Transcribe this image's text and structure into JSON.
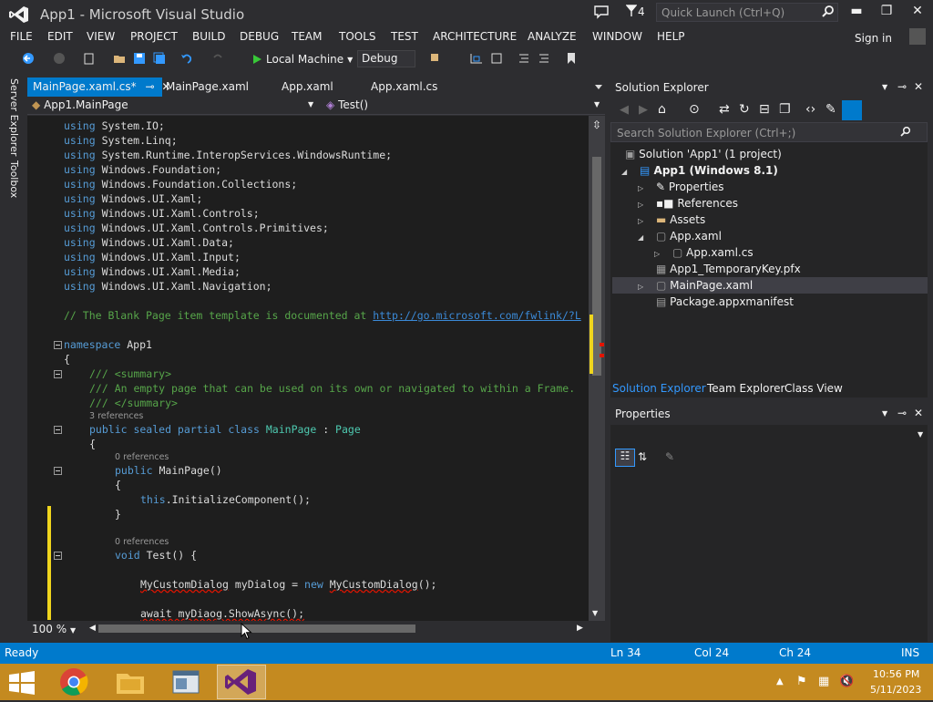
{
  "window": {
    "title": "App1 - Microsoft Visual Studio",
    "notification_count": "4",
    "quick_launch_placeholder": "Quick Launch (Ctrl+Q)",
    "minimize": "▬",
    "maximize": "❐",
    "close": "✕"
  },
  "menu": {
    "items": [
      "FILE",
      "EDIT",
      "VIEW",
      "PROJECT",
      "BUILD",
      "DEBUG",
      "TEAM",
      "TOOLS",
      "TEST",
      "ARCHITECTURE",
      "ANALYZE",
      "WINDOW",
      "HELP"
    ],
    "sign_in": "Sign in"
  },
  "toolbar": {
    "run_target": "Local Machine",
    "configuration": "Debug"
  },
  "left_strip": {
    "server_explorer": "Server Explorer",
    "toolbox": "Toolbox"
  },
  "doc_tabs": {
    "active": "MainPage.xaml.cs*",
    "tab2": "MainPage.xaml",
    "tab3": "App.xaml",
    "tab4": "App.xaml.cs"
  },
  "nav_bar": {
    "class": "App1.MainPage",
    "member": "Test()"
  },
  "code": {
    "using1": "System.IO;",
    "using2": "System.Linq;",
    "using3": "System.Runtime.InteropServices.WindowsRuntime;",
    "using4": "Windows.Foundation;",
    "using5": "Windows.Foundation.Collections;",
    "using6": "Windows.UI.Xaml;",
    "using7": "Windows.UI.Xaml.Controls;",
    "using8": "Windows.UI.Xaml.Controls.Primitives;",
    "using9": "Windows.UI.Xaml.Data;",
    "using10": "Windows.UI.Xaml.Input;",
    "using11": "Windows.UI.Xaml.Media;",
    "using12": "Windows.UI.Xaml.Navigation;",
    "using_kw": "using",
    "comment_blank": "// The Blank Page item template is documented at ",
    "comment_link": "http://go.microsoft.com/fwlink/?L",
    "ns_kw": "namespace",
    "ns_name": " App1",
    "brace_open": "{",
    "brace_close": "}",
    "summary_open": "/// <summary>",
    "summary_text": "/// An empty page that can be used on its own or navigated to within a Frame.",
    "summary_close": "/// </summary>",
    "refs3": "3 references",
    "class_kw": "public sealed partial class",
    "class_name": "MainPage",
    "class_colon": " : ",
    "class_base": "Page",
    "refs0a": "0 references",
    "ctor_kw": "public",
    "ctor_name": " MainPage()",
    "init_this": "this",
    "init_call": ".InitializeComponent();",
    "refs0b": "0 references",
    "void_kw": "void",
    "test_sig": " Test() {",
    "dialog_type": "MyCustomDialog",
    "dialog_var": " myDialog = ",
    "new_kw": "new",
    "dialog_ctor": "MyCustomDialog",
    "dialog_end": "();",
    "await_line": "await myDiaog.ShowAsync();"
  },
  "editor": {
    "zoom": "100 %"
  },
  "solution_explorer": {
    "title": "Solution Explorer",
    "search_placeholder": "Search Solution Explorer (Ctrl+;)",
    "items": [
      "Solution 'App1' (1 project)",
      "App1 (Windows 8.1)",
      "Properties",
      "References",
      "Assets",
      "App.xaml",
      "App.xaml.cs",
      "App1_TemporaryKey.pfx",
      "MainPage.xaml",
      "Package.appxmanifest"
    ],
    "tabs": [
      "Solution Explorer",
      "Team Explorer",
      "Class View"
    ]
  },
  "properties": {
    "title": "Properties"
  },
  "status": {
    "state": "Ready",
    "line": "Ln 34",
    "col": "Col 24",
    "ch": "Ch 24",
    "mode": "INS"
  },
  "taskbar": {
    "time": "10:56 PM",
    "date": "5/11/2023"
  },
  "colors": {
    "accent": "#007acc",
    "taskbar": "#c48a20",
    "editor_bg": "#1e1e1e"
  }
}
